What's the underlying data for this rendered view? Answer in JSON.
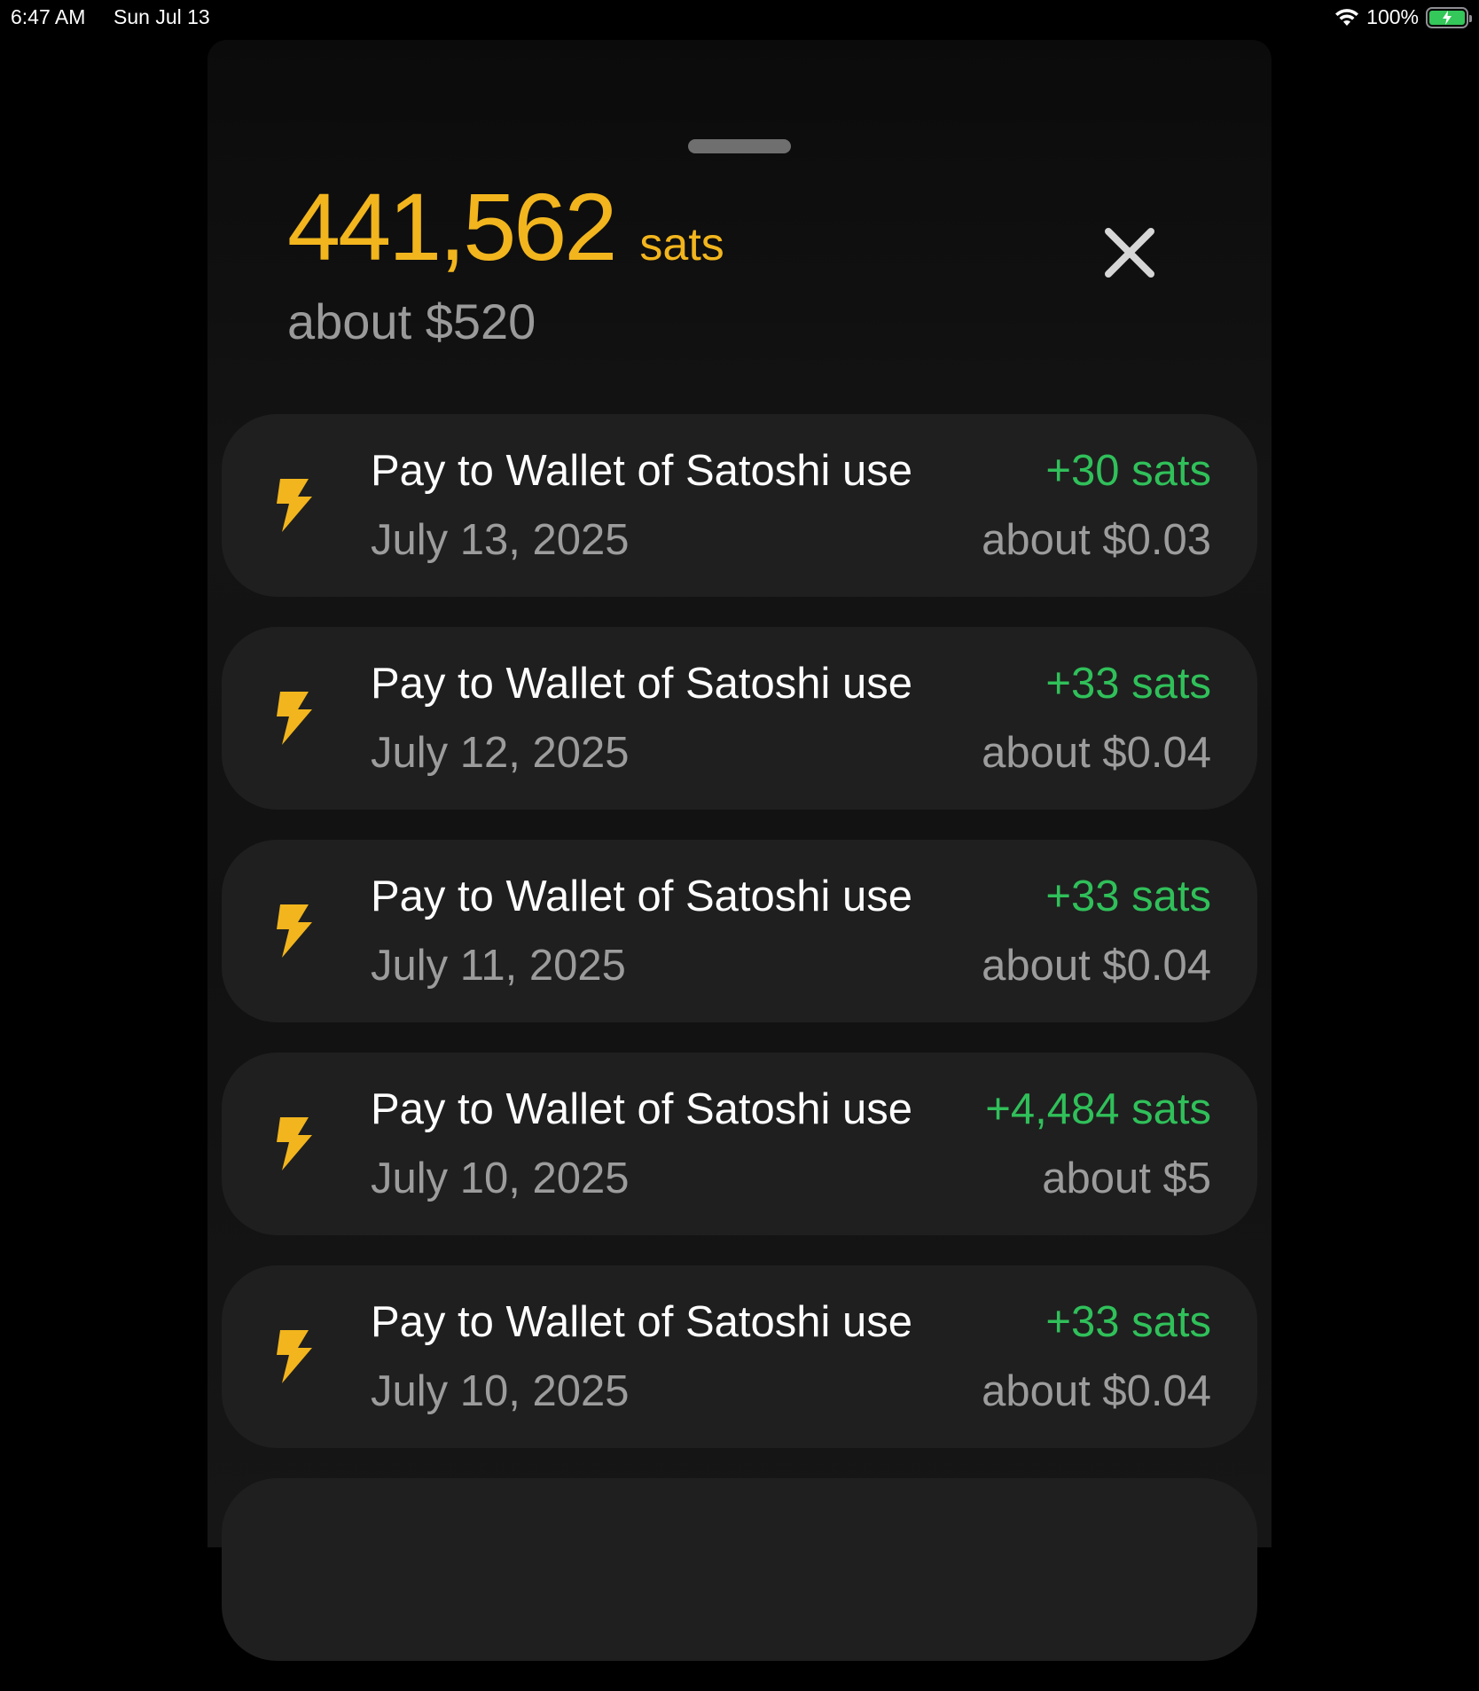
{
  "status_bar": {
    "time": "6:47 AM",
    "date": "Sun Jul 13",
    "battery_percent": "100%"
  },
  "wallet": {
    "balance_amount": "441,562",
    "balance_unit": "sats",
    "balance_fiat": "about $520"
  },
  "colors": {
    "accent": "#f2b51d",
    "positive": "#30c05a",
    "secondary_text": "#9c9c9c",
    "card_bg": "#1f1f1f"
  },
  "transactions": [
    {
      "icon": "lightning-icon",
      "title": "Pay to Wallet of Satoshi use",
      "date": "July 13, 2025",
      "amount": "+30 sats",
      "fiat": "about $0.03"
    },
    {
      "icon": "lightning-icon",
      "title": "Pay to Wallet of Satoshi use",
      "date": "July 12, 2025",
      "amount": "+33 sats",
      "fiat": "about $0.04"
    },
    {
      "icon": "lightning-icon",
      "title": "Pay to Wallet of Satoshi use",
      "date": "July 11, 2025",
      "amount": "+33 sats",
      "fiat": "about $0.04"
    },
    {
      "icon": "lightning-icon",
      "title": "Pay to Wallet of Satoshi use",
      "date": "July 10, 2025",
      "amount": "+4,484 sats",
      "fiat": "about $5"
    },
    {
      "icon": "lightning-icon",
      "title": "Pay to Wallet of Satoshi use",
      "date": "July 10, 2025",
      "amount": "+33 sats",
      "fiat": "about $0.04"
    }
  ]
}
